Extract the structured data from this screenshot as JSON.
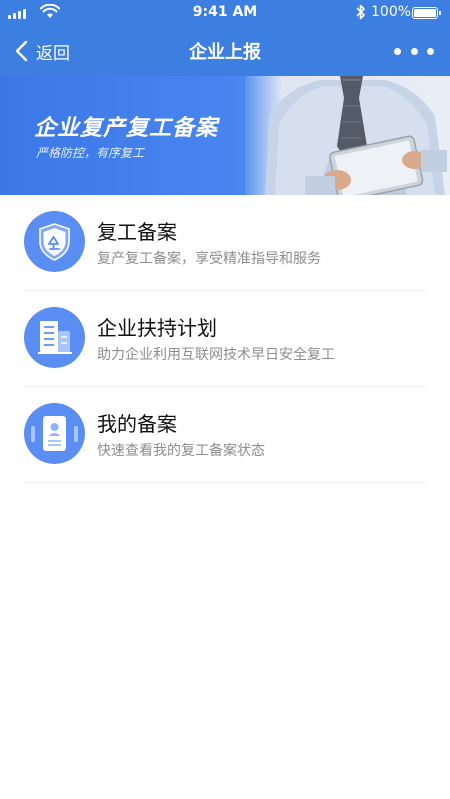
{
  "status_bar": {
    "time": "9:41 AM",
    "battery_percent": "100%",
    "icons": [
      "signal-icon",
      "wifi-icon",
      "bluetooth-icon",
      "battery-icon"
    ]
  },
  "nav": {
    "back_label": "返回",
    "title": "企业上报",
    "back_icon": "chevron-left-icon",
    "more_icon": "more-icon"
  },
  "banner": {
    "title": "企业复产复工备案",
    "subtitle": "严格防控，有序复工"
  },
  "items": [
    {
      "title": "复工备案",
      "desc": "复产复工备案，享受精准指导和服务",
      "icon": "shield-icon"
    },
    {
      "title": "企业扶持计划",
      "desc": "助力企业利用互联网技术早日安全复工",
      "icon": "building-icon"
    },
    {
      "title": "我的备案",
      "desc": "快速查看我的复工备案状态",
      "icon": "document-icon"
    }
  ],
  "colors": {
    "header": "#3d7fe0",
    "icon_circle": "#5a8ef3",
    "title_text": "#111111",
    "desc_text": "#8d8d8d"
  }
}
